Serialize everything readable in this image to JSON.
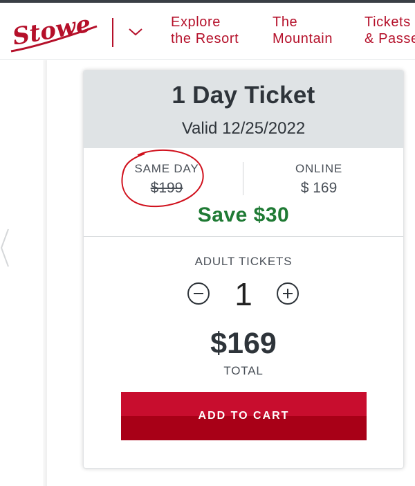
{
  "header": {
    "logo_text": "Stowe",
    "nav": [
      {
        "line1": "Explore",
        "line2": "the Resort"
      },
      {
        "line1": "The",
        "line2": "Mountain"
      },
      {
        "line1": "Tickets",
        "line2": "& Passes"
      }
    ]
  },
  "card": {
    "title": "1 Day Ticket",
    "valid": "Valid 12/25/2022",
    "same_day_label": "SAME DAY",
    "same_day_price": "$199",
    "online_label": "ONLINE",
    "online_price": "$ 169",
    "save": "Save $30",
    "qty_label": "ADULT TICKETS",
    "qty_value": "1",
    "total": "$169",
    "total_label": "TOTAL",
    "cart_button": "ADD TO CART"
  },
  "colors": {
    "brand_red": "#b5102a",
    "save_green": "#1f7a34",
    "button_red": "#c80d2e",
    "annotation_red": "#d0101c"
  },
  "icons": [
    "stowe-logo",
    "chevron-down-icon",
    "chevron-left-icon",
    "minus-icon",
    "plus-icon"
  ]
}
